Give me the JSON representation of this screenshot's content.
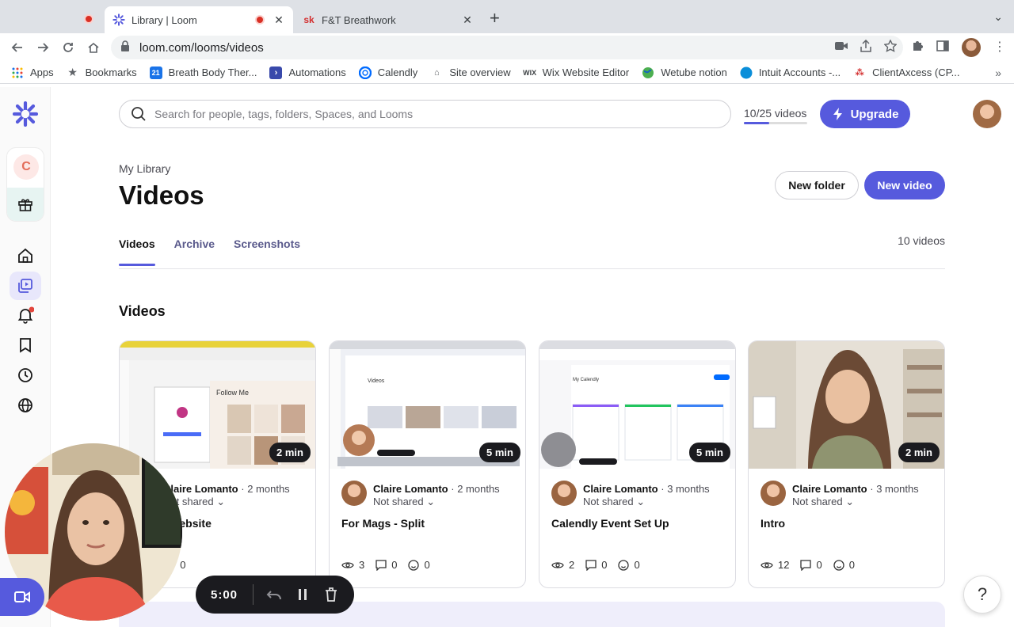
{
  "browser": {
    "tabs": [
      {
        "title": "Library | Loom",
        "active": true,
        "recording": true
      },
      {
        "title": "F&T Breathwork",
        "active": false,
        "favicon_text": "sk"
      }
    ],
    "url": "loom.com/looms/videos",
    "bookmarks": [
      {
        "label": "Apps",
        "icon": "apps-grid-icon"
      },
      {
        "label": "Bookmarks",
        "icon": "star-icon"
      },
      {
        "label": "Breath Body Ther...",
        "icon": "calendar-icon"
      },
      {
        "label": "Automations",
        "icon": "arrow-icon"
      },
      {
        "label": "Calendly",
        "icon": "calendly-icon"
      },
      {
        "label": "Site overview",
        "icon": "site-icon"
      },
      {
        "label": "Wix Website Editor",
        "icon": "wix-icon"
      },
      {
        "label": "Wetube notion",
        "icon": "globe-icon"
      },
      {
        "label": "Intuit Accounts -...",
        "icon": "intuit-icon"
      },
      {
        "label": "ClientAxcess (CP...",
        "icon": "clientaxcess-icon"
      }
    ],
    "more_bookmarks": "»"
  },
  "app": {
    "brand_color": "#565ADD",
    "sidebar": {
      "team_initial": "C"
    },
    "search": {
      "placeholder": "Search for people, tags, folders, Spaces, and Looms"
    },
    "quota": {
      "label": "10/25 videos",
      "used": 10,
      "limit": 25
    },
    "upgrade_label": "Upgrade",
    "breadcrumb": "My Library",
    "page_title": "Videos",
    "new_folder_label": "New folder",
    "new_video_label": "New video",
    "tabs": [
      {
        "label": "Videos",
        "active": true
      },
      {
        "label": "Archive",
        "active": false
      },
      {
        "label": "Screenshots",
        "active": false
      }
    ],
    "video_count": "10 videos",
    "section_title": "Videos",
    "videos": [
      {
        "duration": "2 min",
        "author": "Claire Lomanto",
        "ago": "2 months",
        "shared": "Not shared",
        "title": "/FB on Website",
        "views": "",
        "comments": "0",
        "reactions": "0"
      },
      {
        "duration": "5 min",
        "author": "Claire Lomanto",
        "ago": "2 months",
        "shared": "Not shared",
        "title": "For Mags - Split",
        "views": "3",
        "comments": "0",
        "reactions": "0"
      },
      {
        "duration": "5 min",
        "author": "Claire Lomanto",
        "ago": "3 months",
        "shared": "Not shared",
        "title": "Calendly Event Set Up",
        "views": "2",
        "comments": "0",
        "reactions": "0"
      },
      {
        "duration": "2 min",
        "author": "Claire Lomanto",
        "ago": "3 months",
        "shared": "Not shared",
        "title": "Intro",
        "views": "12",
        "comments": "0",
        "reactions": "0"
      }
    ],
    "recorder": {
      "time": "5:00"
    },
    "help_label": "?"
  }
}
